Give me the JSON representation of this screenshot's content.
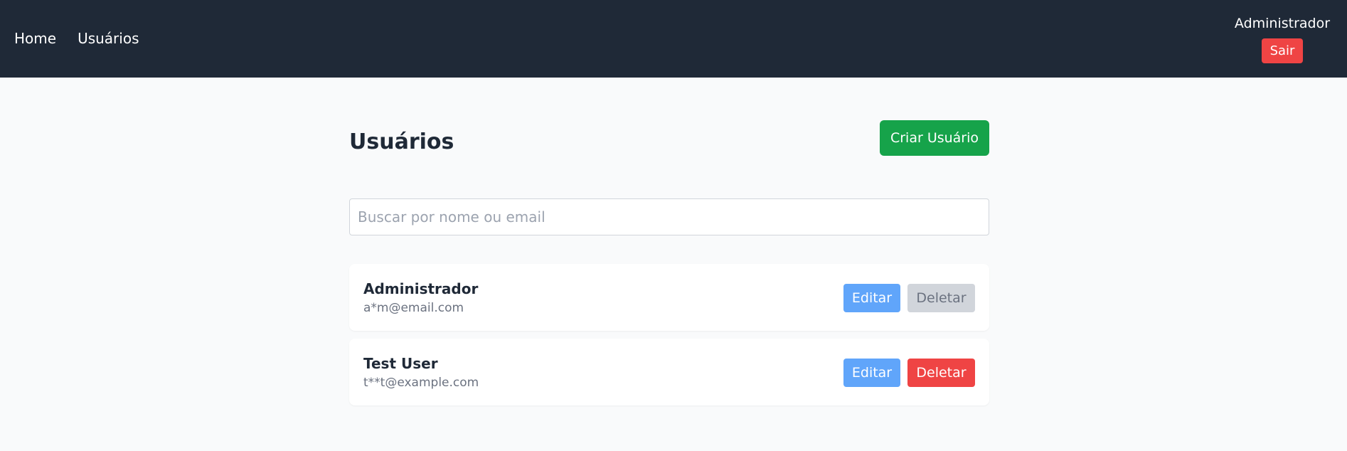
{
  "nav": {
    "links": [
      {
        "label": "Home"
      },
      {
        "label": "Usuários"
      }
    ],
    "user_name": "Administrador",
    "logout_label": "Sair"
  },
  "main": {
    "title": "Usuários",
    "create_label": "Criar Usuário",
    "search": {
      "placeholder": "Buscar por nome ou email",
      "value": ""
    },
    "users": [
      {
        "name": "Administrador",
        "email": "a*m@email.com",
        "edit_label": "Editar",
        "delete_label": "Deletar",
        "delete_disabled": true
      },
      {
        "name": "Test User",
        "email": "t**t@example.com",
        "edit_label": "Editar",
        "delete_label": "Deletar",
        "delete_disabled": false
      }
    ]
  },
  "colors": {
    "navbar": "#1f2937",
    "accent_green": "#16a34a",
    "danger": "#ef4444",
    "edit_blue": "#60a5fa",
    "disabled": "#d1d5db"
  }
}
